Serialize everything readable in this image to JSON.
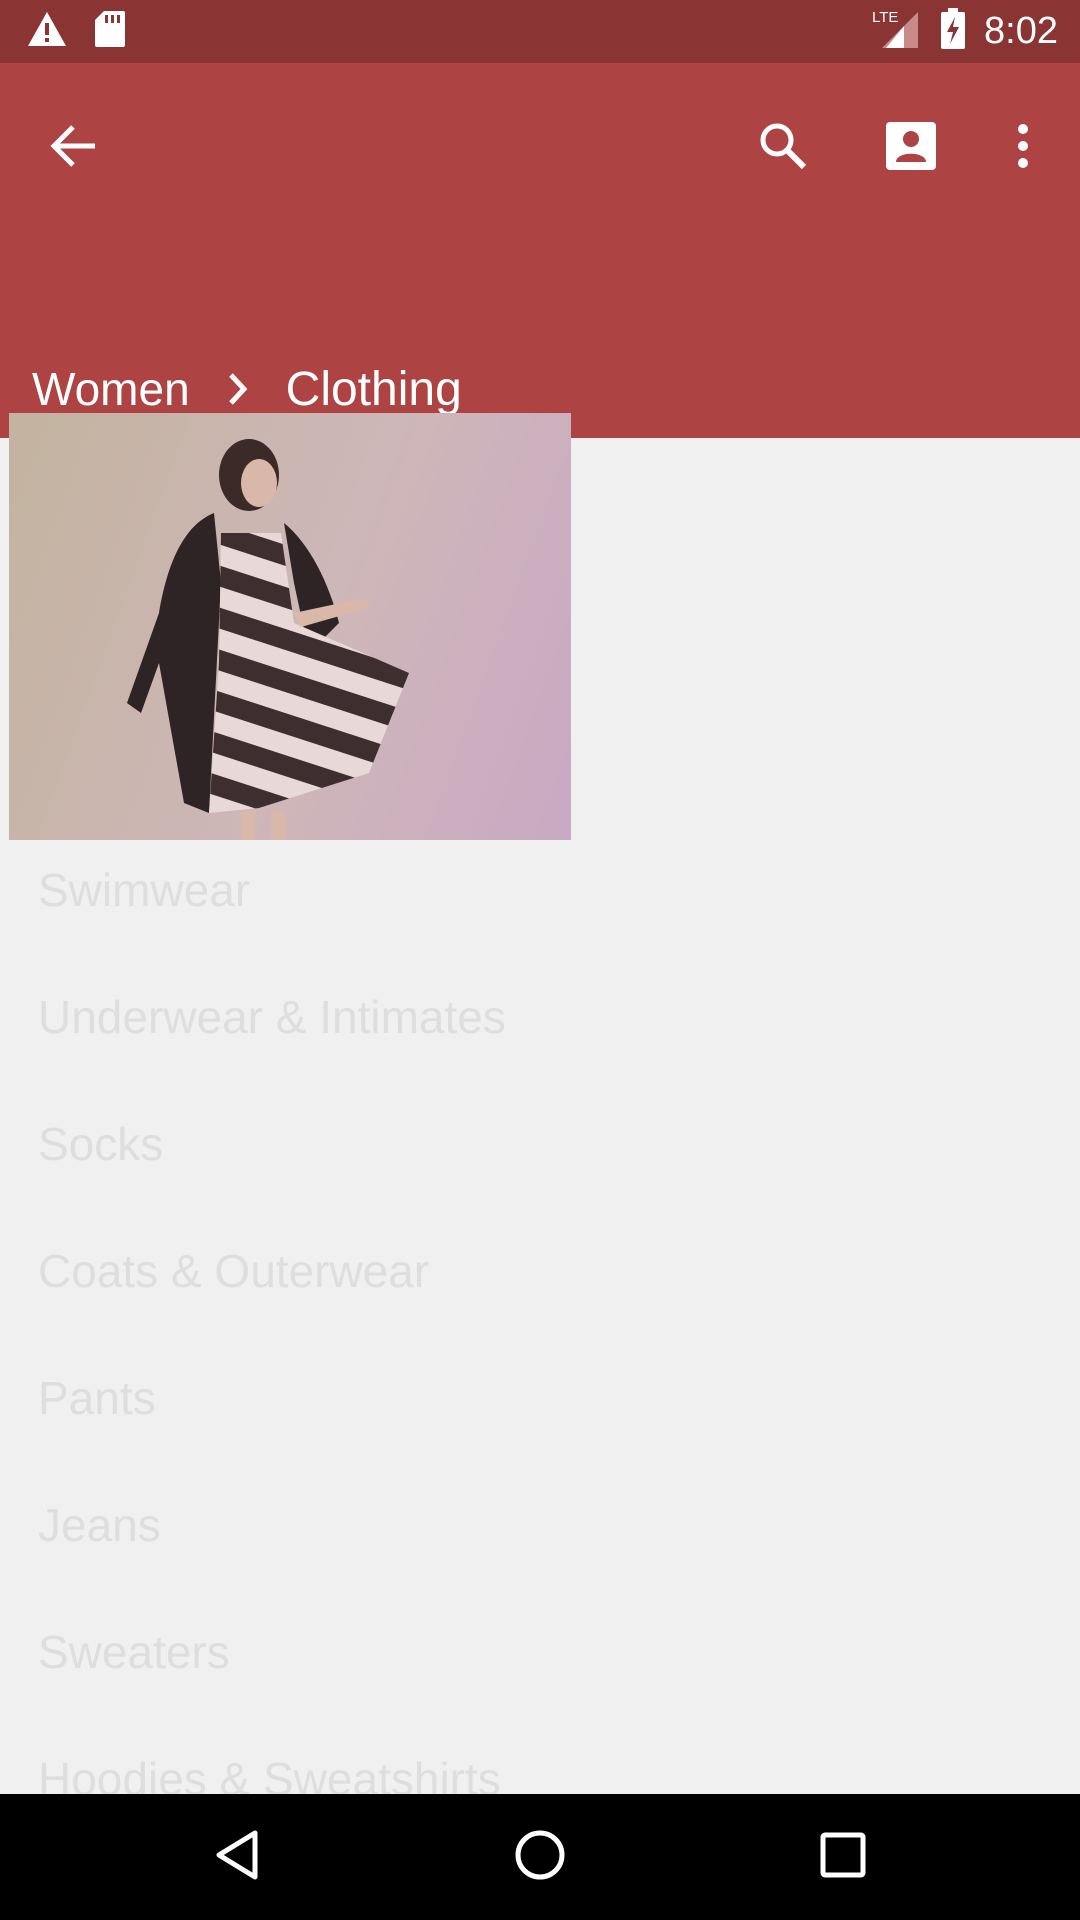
{
  "status_bar": {
    "time": "8:02",
    "network": "LTE",
    "icons": [
      "warning-icon",
      "sd-card-icon",
      "lte-signal-icon",
      "battery-charging-icon"
    ]
  },
  "app_bar": {
    "background": "#ad4343",
    "actions": [
      "back-arrow-icon",
      "search-icon",
      "account-icon",
      "more-vert-icon"
    ]
  },
  "breadcrumb": {
    "parent": "Women",
    "current": "Clothing"
  },
  "hero": {
    "image": "woman-in-striped-dress-photo"
  },
  "categories": [
    "Swimwear",
    "Underwear & Intimates",
    "Socks",
    "Coats & Outerwear",
    "Pants",
    "Jeans",
    "Sweaters",
    "Hoodies & Sweatshirts"
  ],
  "nav_bar": {
    "buttons": [
      "back-triangle-icon",
      "home-circle-icon",
      "recents-square-icon"
    ]
  }
}
